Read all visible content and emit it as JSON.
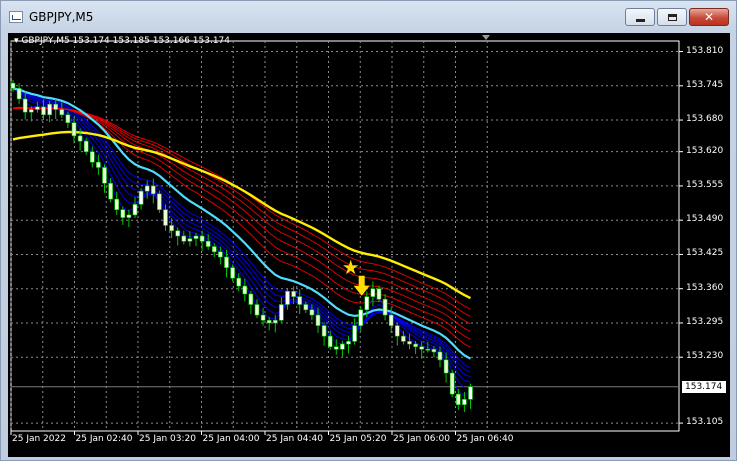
{
  "window": {
    "title": "GBPJPY,M5",
    "icon": "chart-window-icon",
    "buttons": {
      "minimize": "minimize-icon",
      "maximize": "maximize-icon",
      "close": "close-icon"
    }
  },
  "chart": {
    "info": "GBPJPY,M5  153.174 153.185 153.166 153.174",
    "current_price": "153.174",
    "colors": {
      "background": "#000000",
      "grid": "#8c8c8c",
      "bull_candle": "#ffffff",
      "bear_candle": "#e8ffd0",
      "wick": "#00c800",
      "ema_fast": "#0000ff",
      "ema_slow": "#ff0000",
      "line_aqua": "#4fdcff",
      "line_yellow": "#ffee00",
      "signal": "#ffdd00"
    }
  },
  "chart_data": {
    "type": "candlestick",
    "symbol": "GBPJPY",
    "timeframe": "M5",
    "yticks": [
      "153.810",
      "153.745",
      "153.680",
      "153.620",
      "153.555",
      "153.490",
      "153.425",
      "153.360",
      "153.295",
      "153.230",
      "153.174",
      "153.105"
    ],
    "xticks": [
      "25 Jan 2022",
      "25 Jan 02:40",
      "25 Jan 03:20",
      "25 Jan 04:00",
      "25 Jan 04:40",
      "25 Jan 05:20",
      "25 Jan 06:00",
      "25 Jan 06:40"
    ],
    "ylim": [
      153.09,
      153.83
    ],
    "closes": [
      153.74,
      153.72,
      153.695,
      153.7,
      153.705,
      153.69,
      153.71,
      153.7,
      153.69,
      153.675,
      153.65,
      153.64,
      153.62,
      153.6,
      153.59,
      153.56,
      153.53,
      153.51,
      153.495,
      153.5,
      153.52,
      153.545,
      153.555,
      153.54,
      153.51,
      153.48,
      153.47,
      153.46,
      153.45,
      153.455,
      153.46,
      153.45,
      153.44,
      153.43,
      153.42,
      153.4,
      153.38,
      153.365,
      153.35,
      153.33,
      153.31,
      153.3,
      153.295,
      153.3,
      153.33,
      153.355,
      153.345,
      153.33,
      153.32,
      153.31,
      153.29,
      153.27,
      153.25,
      153.245,
      153.255,
      153.26,
      153.29,
      153.32,
      153.345,
      153.36,
      153.34,
      153.31,
      153.29,
      153.27,
      153.26,
      153.255,
      153.25,
      153.245,
      153.245,
      153.24,
      153.225,
      153.2,
      153.16,
      153.14,
      153.15,
      153.174
    ],
    "signal": {
      "type": "sell",
      "marker": "star-and-down-arrow",
      "candle_index": 57
    }
  }
}
